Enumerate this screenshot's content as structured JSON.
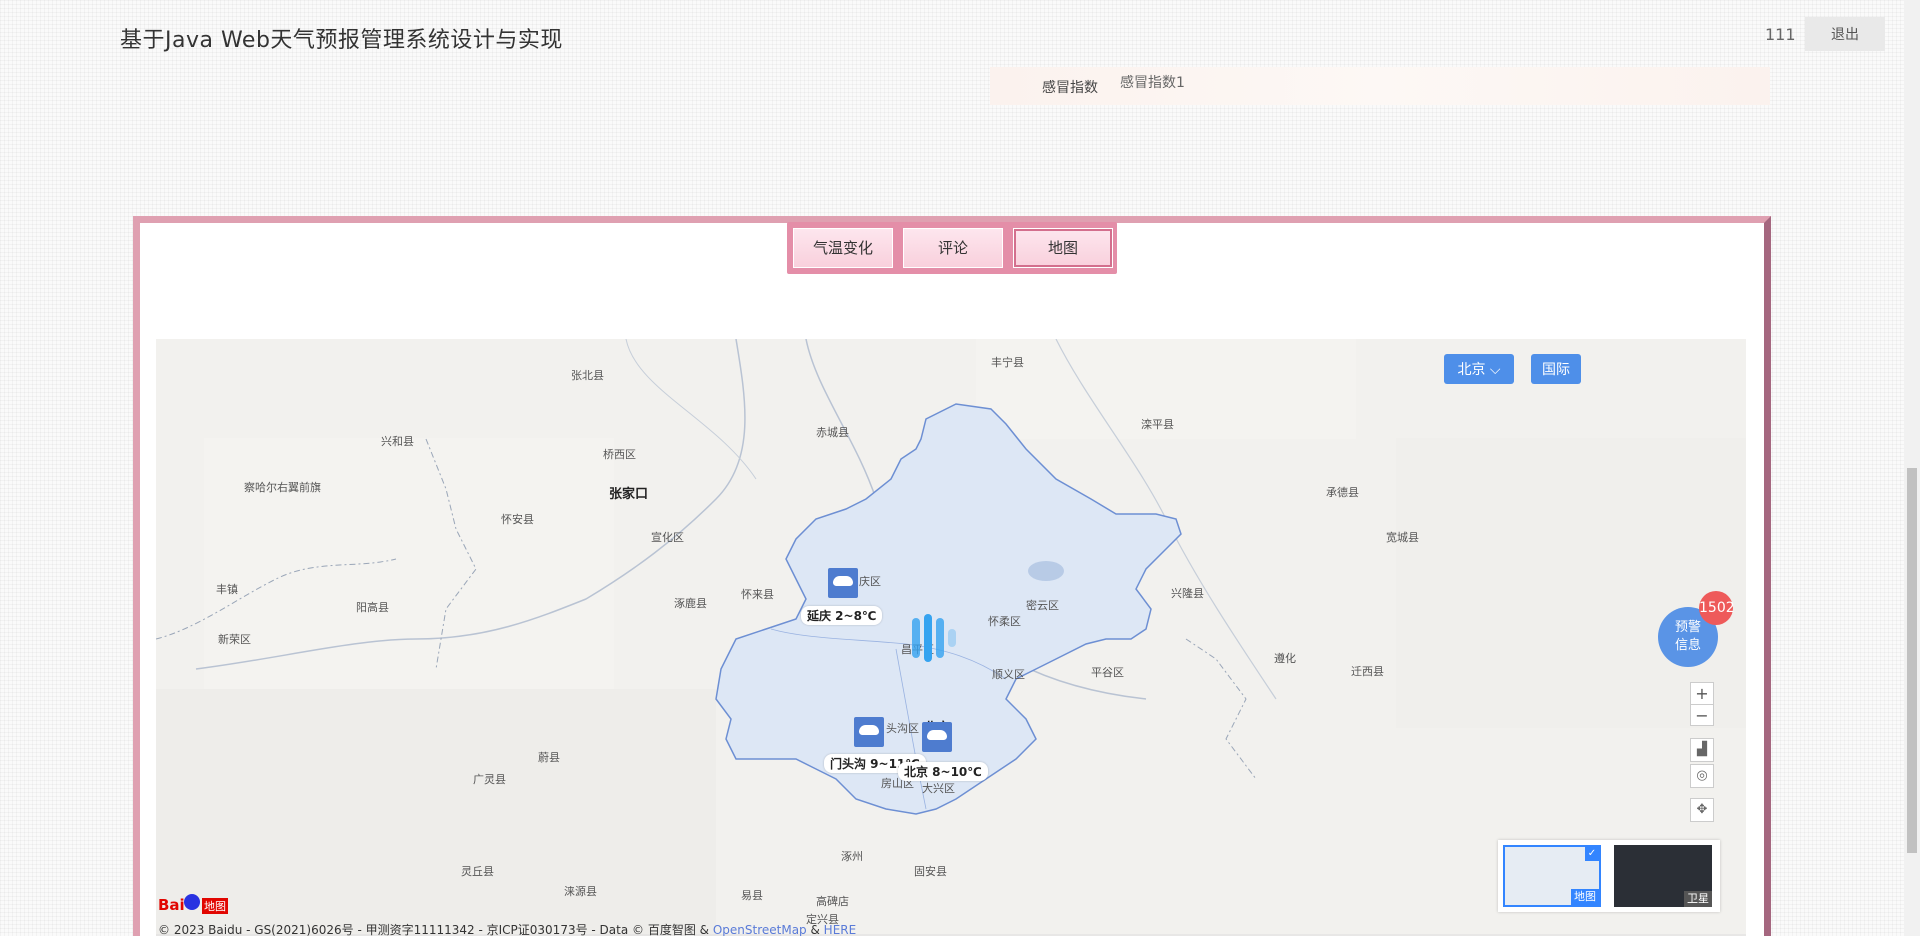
{
  "header": {
    "title": "基于Java Web天气预报管理系统设计与实现",
    "user": "111",
    "logout_label": "退出"
  },
  "index_row": {
    "label": "感冒指数",
    "value": "感冒指数1"
  },
  "tabs": [
    "气温变化",
    "评论",
    "地图"
  ],
  "active_tab": "地图",
  "map": {
    "city_select": "北京",
    "intl_label": "国际",
    "alert_label_1": "预警",
    "alert_label_2": "信息",
    "alert_count": "1502",
    "zoom_in": "+",
    "zoom_out": "−",
    "map_type_normal": "地图",
    "map_type_satellite": "卫星",
    "labels": [
      "张北县",
      "丰宁县",
      "赤城县",
      "滦平县",
      "兴和县",
      "桥西区",
      "张家口",
      "察哈尔右翼前旗",
      "怀安县",
      "宣化区",
      "承德县",
      "宽城县",
      "丰镇",
      "怀来县",
      "涿鹿县",
      "兴隆县",
      "阳高县",
      "庆区",
      "密云区",
      "怀柔区",
      "新荣区",
      "遵化",
      "迁西县",
      "顺义区",
      "平谷区",
      "昌平区",
      "头沟区",
      "大兴区",
      "房山区",
      "蔚县",
      "广灵县",
      "涞源县",
      "易县",
      "涿州",
      "固安县",
      "灵丘县",
      "高碑店",
      "定兴县",
      "北京"
    ],
    "weather_tags": [
      "延庆 2~8℃",
      "门头沟 9~11℃",
      "北京 8~10℃"
    ],
    "copyright_text": "© 2023 Baidu - GS(2021)6026号 - 甲测资字11111342 - 京ICP证030173号 - Data © 百度智图 & ",
    "copyright_link1": "OpenStreetMap",
    "copyright_amp": " & ",
    "copyright_link2": "HERE",
    "logo_text": "Bai",
    "logo_text2": "地图"
  },
  "colors": {
    "panel_border": "#dfa0b1",
    "tab_bar": "#e48ea8",
    "map_button": "#4e8fe9",
    "alert_badge": "#ee5a5a",
    "region_fill": "#dde7f5",
    "region_stroke": "#6d8fd3"
  }
}
